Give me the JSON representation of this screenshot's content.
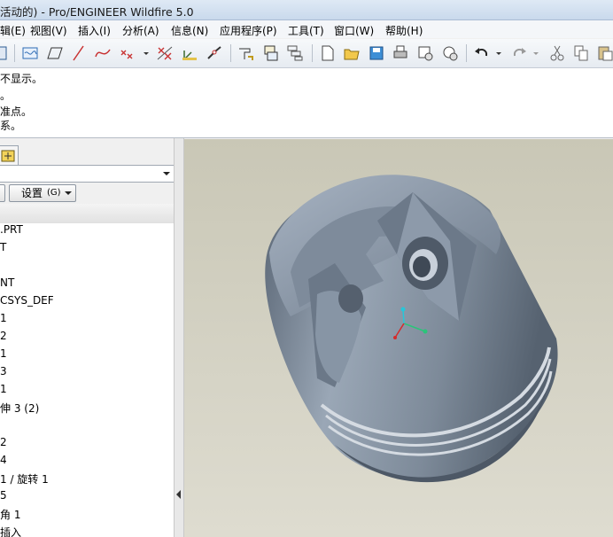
{
  "window": {
    "title": "活动的) - Pro/ENGINEER Wildfire 5.0"
  },
  "menubar": {
    "items": [
      {
        "label": "辑(E)"
      },
      {
        "label": "视图(V)"
      },
      {
        "label": "插入(I)"
      },
      {
        "label": "分析(A)"
      },
      {
        "label": "信息(N)"
      },
      {
        "label": "应用程序(P)"
      },
      {
        "label": "工具(T)"
      },
      {
        "label": "窗口(W)"
      },
      {
        "label": "帮助(H)"
      }
    ]
  },
  "toolbar": {
    "icons": [
      "datum-plane-icon",
      "datum-axis-icon",
      "sketch-icon",
      "curve-icon",
      "datum-point-icon",
      "point-offset-icon",
      "csys-icon",
      "analysis-icon",
      "annotation-icon",
      "view-manager-icon",
      "layer-icon",
      "new-file-icon",
      "open-folder-icon",
      "save-icon",
      "print-icon",
      "mail-icon",
      "mail-recipient-icon",
      "undo-icon",
      "redo-icon",
      "cut-icon",
      "copy-icon",
      "paste-icon"
    ]
  },
  "messages": [
    {
      "text": "不显示。"
    },
    {
      "text": "。"
    },
    {
      "text": "准点。"
    },
    {
      "text": "系。"
    }
  ],
  "panel": {
    "tab_icon": "model-tree-tab-icon",
    "settings_label": "设置",
    "settings_shortcut": "G"
  },
  "tree": {
    "rows": [
      {
        "text": ".PRT"
      },
      {
        "text": "T"
      },
      {
        "text": ""
      },
      {
        "text": "NT"
      },
      {
        "text": "CSYS_DEF"
      },
      {
        "text": "1"
      },
      {
        "text": "2"
      },
      {
        "text": "1"
      },
      {
        "text": "3"
      },
      {
        "text": "1"
      },
      {
        "text": "伸 3 (2)"
      },
      {
        "text": ""
      },
      {
        "text": "2"
      },
      {
        "text": "4"
      },
      {
        "text": "1 / 旋转 1"
      },
      {
        "text": "5"
      },
      {
        "text": "角 1"
      },
      {
        "text": "插入"
      }
    ]
  },
  "colors": {
    "viewport_bg": "#d4d2c3",
    "model_steel": "#8d9aa9",
    "csys_x": "#2bc47a",
    "csys_y": "#27c6d9",
    "csys_z": "#d52b2b"
  }
}
